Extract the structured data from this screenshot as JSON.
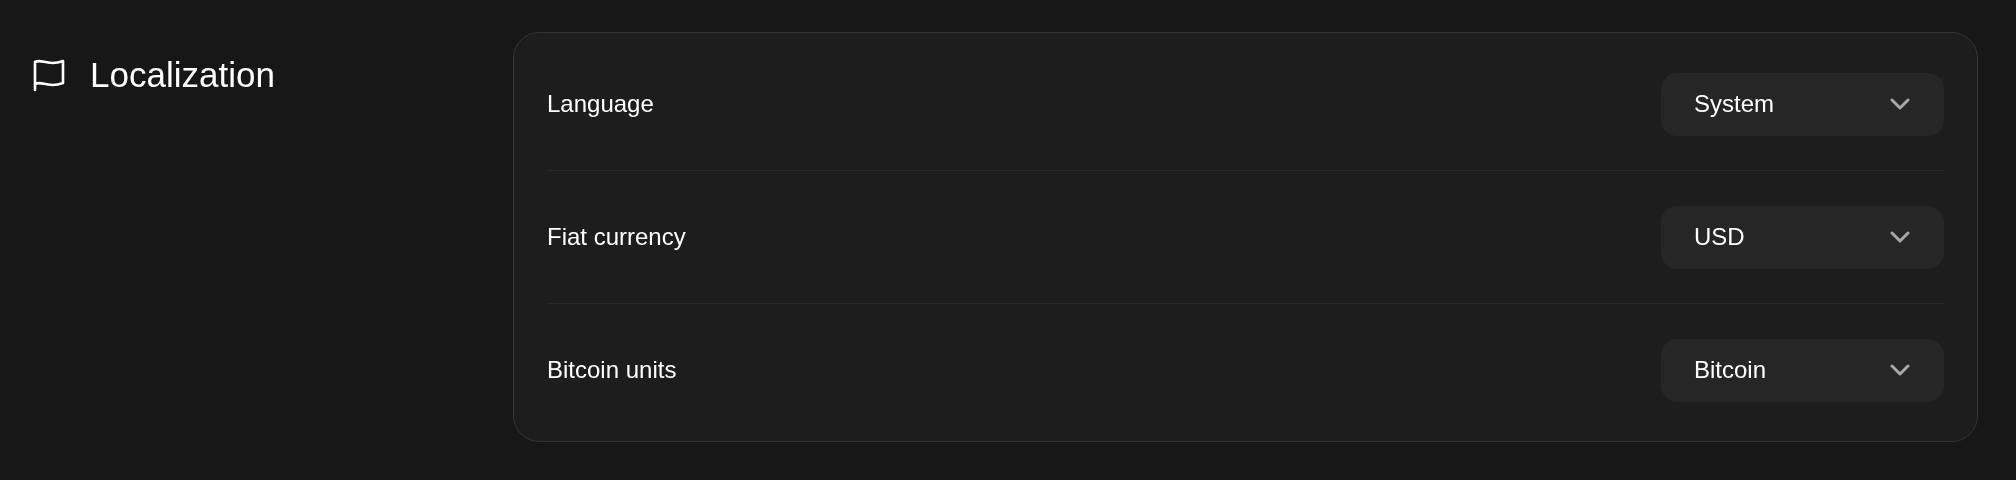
{
  "section": {
    "title": "Localization"
  },
  "settings": [
    {
      "label": "Language",
      "value": "System"
    },
    {
      "label": "Fiat currency",
      "value": "USD"
    },
    {
      "label": "Bitcoin units",
      "value": "Bitcoin"
    }
  ]
}
